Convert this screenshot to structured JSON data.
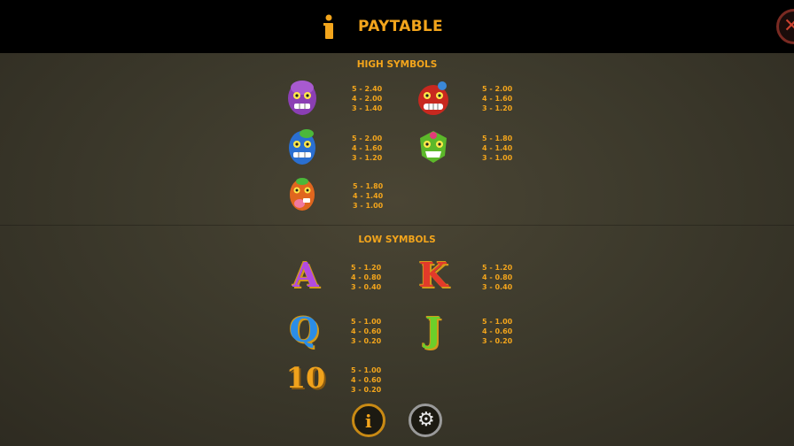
{
  "header": {
    "title": "PAYTABLE",
    "close_label": "✕"
  },
  "sections": {
    "high_title": "HIGH SYMBOLS",
    "low_title": "LOW SYMBOLS"
  },
  "high_symbols": [
    {
      "icon": "purple-mask-icon",
      "color": "#8b3fb4",
      "pays": [
        "5 - 2.40",
        "4 - 2.00",
        "3 - 1.40"
      ]
    },
    {
      "icon": "red-mask-icon",
      "color": "#c8281f",
      "pays": [
        "5 - 2.00",
        "4 - 1.60",
        "3 - 1.20"
      ]
    },
    {
      "icon": "blue-mask-icon",
      "color": "#2a6fd1",
      "pays": [
        "5 - 2.00",
        "4 - 1.60",
        "3 - 1.20"
      ]
    },
    {
      "icon": "green-mask-icon",
      "color": "#5cb82a",
      "pays": [
        "5 - 1.80",
        "4 - 1.40",
        "3 - 1.00"
      ]
    },
    {
      "icon": "orange-mask-icon",
      "color": "#e0661e",
      "pays": [
        "5 - 1.80",
        "4 - 1.40",
        "3 - 1.00"
      ]
    }
  ],
  "low_symbols": [
    {
      "icon": "letter-a-icon",
      "glyph": "A",
      "color": "#b24be0",
      "pays": [
        "5 - 1.20",
        "4 - 0.80",
        "3 - 0.40"
      ]
    },
    {
      "icon": "letter-k-icon",
      "glyph": "K",
      "color": "#e23a2a",
      "pays": [
        "5 - 1.20",
        "4 - 0.80",
        "3 - 0.40"
      ]
    },
    {
      "icon": "letter-q-icon",
      "glyph": "Q",
      "color": "#2b8de6",
      "pays": [
        "5 - 1.00",
        "4 - 0.60",
        "3 - 0.20"
      ]
    },
    {
      "icon": "letter-j-icon",
      "glyph": "J",
      "color": "#6ccf2a",
      "pays": [
        "5 - 1.00",
        "4 - 0.60",
        "3 - 0.20"
      ]
    },
    {
      "icon": "number-10-icon",
      "glyph": "10",
      "color": "#f0a21c",
      "pays": [
        "5 - 1.00",
        "4 - 0.60",
        "3 - 0.20"
      ]
    }
  ],
  "footer": {
    "info_label": "i",
    "settings_label": "⚙"
  }
}
